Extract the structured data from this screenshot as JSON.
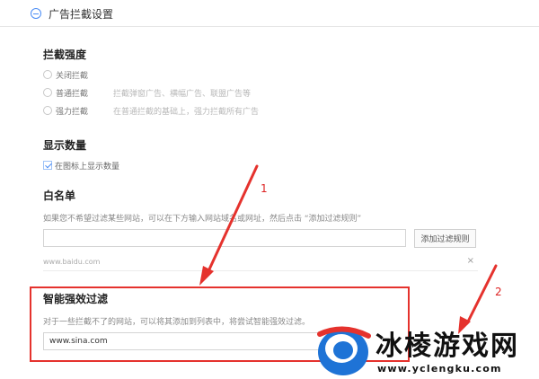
{
  "header": {
    "title": "广告拦截设置"
  },
  "intensity": {
    "title": "拦截强度",
    "options": [
      {
        "label": "关闭拦截",
        "desc": ""
      },
      {
        "label": "普通拦截",
        "desc": "拦截弹窗广告、横幅广告、联盟广告等"
      },
      {
        "label": "强力拦截",
        "desc": "在普通拦截的基础上，强力拦截所有广告"
      }
    ]
  },
  "display": {
    "title": "显示数量",
    "checkbox_label": "在图标上显示数量"
  },
  "whitelist": {
    "title": "白名单",
    "help": "如果您不希望过滤某些网站，可以在下方输入网站域名或网址，然后点击 “添加过滤规则”",
    "input_value": "",
    "add_button": "添加过滤规则",
    "items": [
      {
        "url": "www.baidu.com",
        "remove": "×"
      }
    ]
  },
  "smart": {
    "title": "智能强效过滤",
    "help": "对于一些拦截不了的网站，可以将其添加到列表中，将尝试智能强效过滤。",
    "input_value": "www.sina.com"
  },
  "annotations": {
    "one": "1",
    "two": "2",
    "color": "#e5322d"
  },
  "watermark": {
    "name": "冰棱游戏网",
    "url": "www.yclengku.com"
  }
}
